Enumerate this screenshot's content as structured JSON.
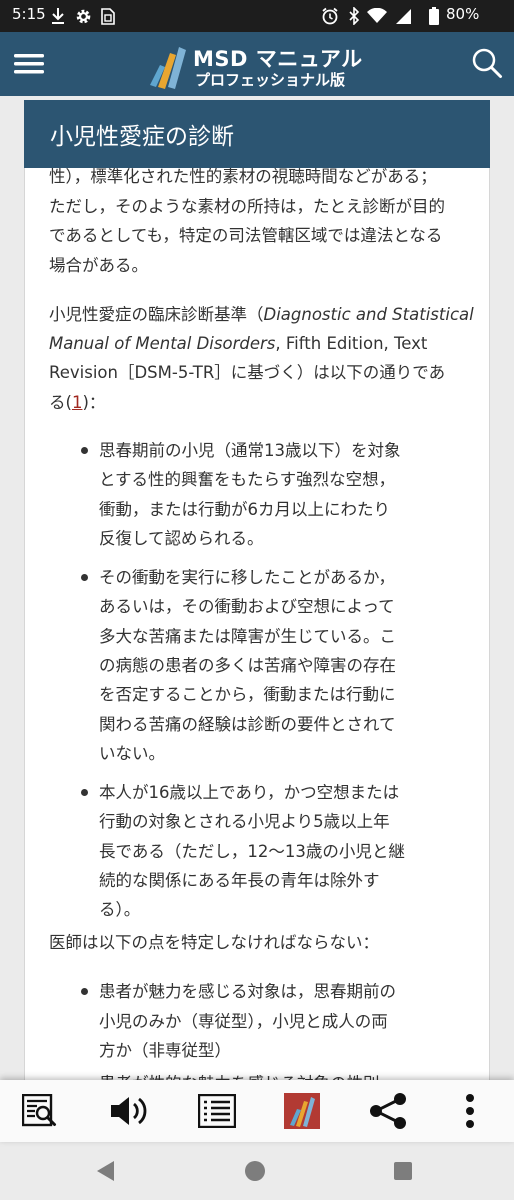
{
  "status_bar": {
    "time": "5:15",
    "battery": "80%",
    "icons": [
      "download-icon",
      "gear-icon",
      "sim-icon",
      "alarm-icon",
      "bluetooth-icon",
      "wifi-icon",
      "signal-icon",
      "battery-icon"
    ]
  },
  "app_bar": {
    "brand_title": "MSD マニュアル",
    "brand_subtitle": "プロフェッショナル版",
    "bg_color": "#2c5572"
  },
  "section": {
    "title": "小児性愛症の診断"
  },
  "content": {
    "intro_lines": [
      "性），標準化された性的素材の視聴時間などがある；",
      "ただし，そのような素材の所持は，たとえ診断が目的",
      "であるとしても，特定の司法管轄区域では違法となる",
      "場合がある。"
    ],
    "criteria_intro": {
      "line1_prefix": "小児性愛症の臨床診断基準（",
      "line1_italic": "Diagnostic and Statistical",
      "line2_italic": "Manual of Mental Disorders",
      "line2_rest": ", Fifth Edition, Text",
      "line3": "Revision［DSM-5-TR］に基づく）は以下の通りであ",
      "line4_prefix": "る(",
      "ref": "1",
      "line4_suffix": ")："
    },
    "criteria": [
      {
        "lines": [
          "思春期前の小児（通常13歳以下）を対象",
          "とする性的興奮をもたらす強烈な空想，",
          "衝動，または行動が6カ月以上にわたり",
          "反復して認められる。"
        ]
      },
      {
        "lines": [
          "その衝動を実行に移したことがあるか，",
          "あるいは，その衝動および空想によって",
          "多大な苦痛または障害が生じている。こ",
          "の病態の患者の多くは苦痛や障害の存在",
          "を否定することから，衝動または行動に",
          "関わる苦痛の経験は診断の要件とされて",
          "いない。"
        ]
      },
      {
        "lines": [
          "本人が16歳以上であり，かつ空想または",
          "行動の対象とされる小児より5歳以上年",
          "長である（ただし，12〜13歳の小児と継",
          "続的な関係にある年長の青年は除外す",
          "る）。"
        ]
      }
    ],
    "specify_intro": "医師は以下の点を特定しなければならない：",
    "specifiers": [
      {
        "lines": [
          "患者が魅力を感じる対象は，思春期前の",
          "小児のみか（専従型），小児と成人の両",
          "方か（非専従型）"
        ]
      }
    ],
    "partial_line": "患者が性的な魅力を感じる対象の性別"
  },
  "toolbar": {
    "items": [
      "search-topic-icon",
      "speaker-icon",
      "outline-list-icon",
      "msd-logo-icon",
      "share-icon",
      "more-vert-icon"
    ]
  },
  "nav_bar": {
    "items": [
      "back-icon",
      "home-icon",
      "recents-icon"
    ]
  }
}
